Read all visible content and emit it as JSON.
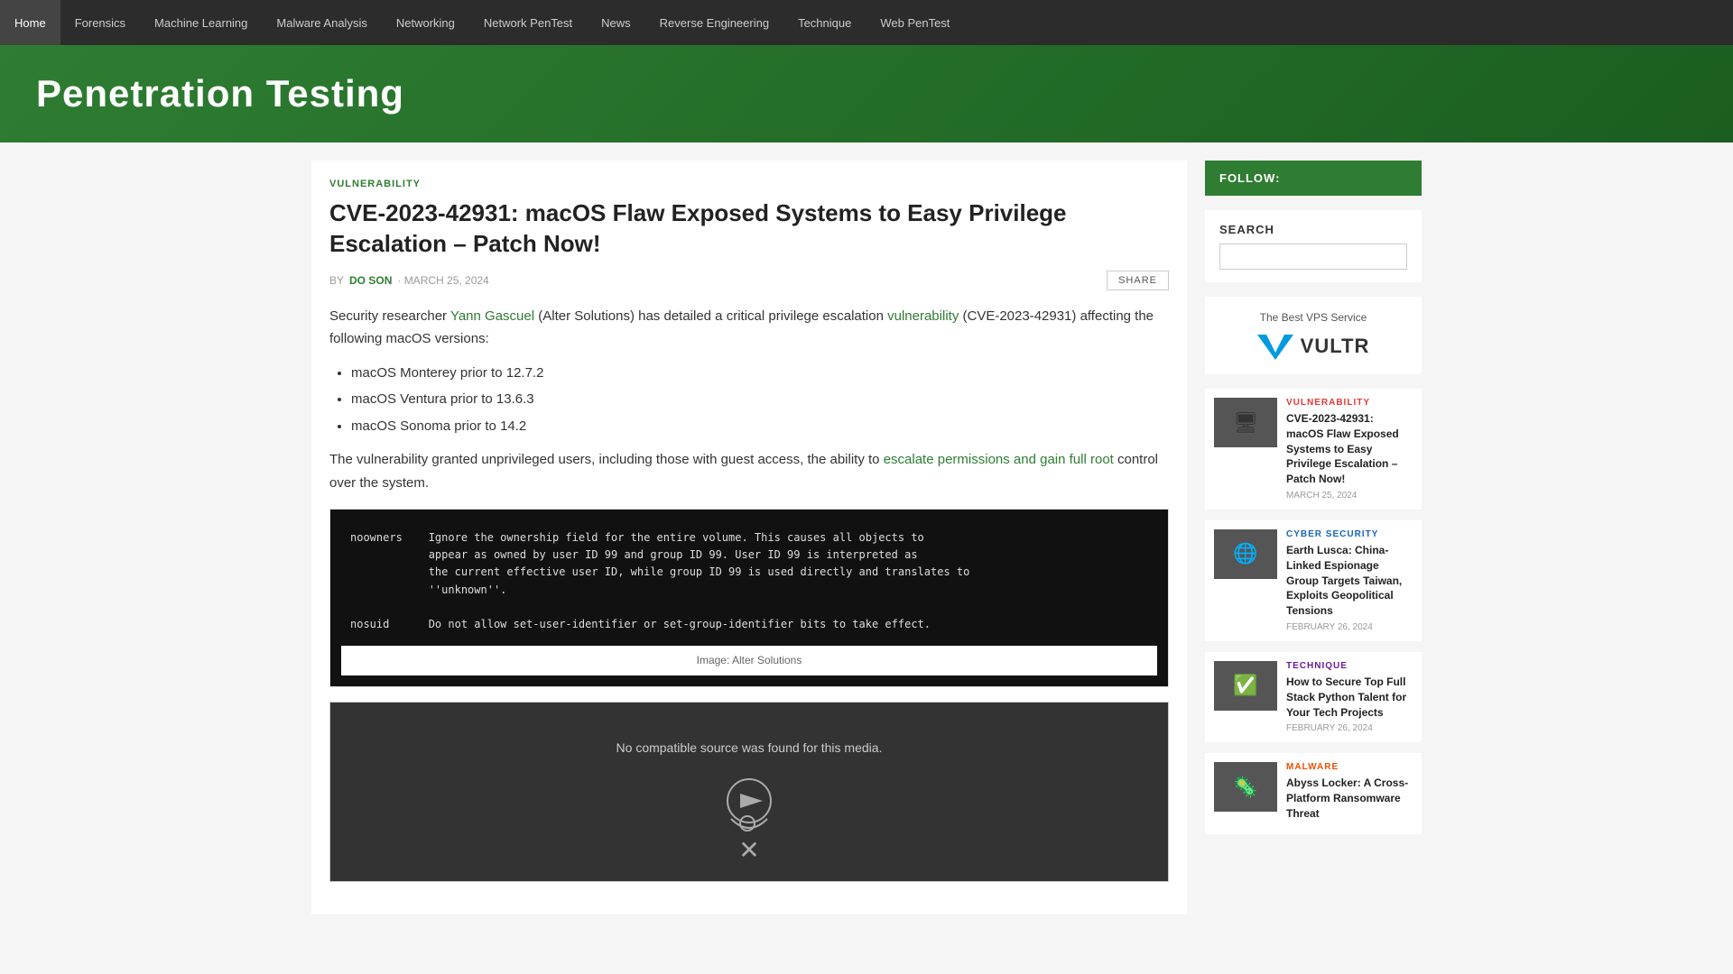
{
  "nav": {
    "items": [
      {
        "label": "Home",
        "active": false
      },
      {
        "label": "Forensics",
        "active": false
      },
      {
        "label": "Machine Learning",
        "active": false
      },
      {
        "label": "Malware Analysis",
        "active": false
      },
      {
        "label": "Networking",
        "active": false
      },
      {
        "label": "Network PenTest",
        "active": false
      },
      {
        "label": "News",
        "active": false
      },
      {
        "label": "Reverse Engineering",
        "active": false
      },
      {
        "label": "Technique",
        "active": false
      },
      {
        "label": "Web PenTest",
        "active": false
      }
    ]
  },
  "header": {
    "title": "Penetration Testing"
  },
  "article": {
    "category": "VULNERABILITY",
    "title": "CVE-2023-42931: macOS Flaw Exposed Systems to Easy Privilege Escalation – Patch Now!",
    "by": "BY",
    "author": "DO SON",
    "date": "· MARCH 25, 2024",
    "share_label": "SHARE",
    "intro": "Security researcher ",
    "researcher": "Yann Gascuel",
    "researcher_suffix": " (Alter Solutions) has detailed a critical privilege escalation ",
    "vuln_link": "vulnerability",
    "vuln_suffix": " (CVE-2023-42931) affecting the following macOS versions:",
    "versions": [
      "macOS Monterey prior to 12.7.2",
      "macOS Ventura prior to 13.6.3",
      "macOS Sonoma prior to 14.2"
    ],
    "body_p2_before": "The vulnerability granted unprivileged users, including those with guest access, the ability to ",
    "body_p2_link": "escalate permissions and gain full root",
    "body_p2_after": " control over the system.",
    "code_block": "noowners    Ignore the ownership field for the entire volume. This causes all objects to\n            appear as owned by user ID 99 and group ID 99. User ID 99 is interpreted as\n            the current effective user ID, while group ID 99 is used directly and translates to\n            ''unknown''.\n\nnosuid      Do not allow set-user-identifier or set-group-identifier bits to take effect.",
    "image_caption": "Image: Alter Solutions",
    "video_no_source": "No compatible source was found for this media."
  },
  "sidebar": {
    "follow_label": "FOLLOW:",
    "search_label": "SEARCH",
    "search_placeholder": "",
    "vps_title": "The Best VPS Service",
    "vps_name": "VULTR",
    "articles": [
      {
        "category": "VULNERABILITY",
        "cat_class": "vulnerability",
        "thumb_class": "thumb-vuln",
        "thumb_icon": "🖥",
        "title": "CVE-2023-42931: macOS Flaw Exposed Systems to Easy Privilege Escalation – Patch Now!",
        "date": "MARCH 25, 2024"
      },
      {
        "category": "CYBER SECURITY",
        "cat_class": "cyber",
        "thumb_class": "thumb-cyber",
        "thumb_icon": "🌐",
        "title": "Earth Lusca: China-Linked Espionage Group Targets Taiwan, Exploits Geopolitical Tensions",
        "date": "FEBRUARY 26, 2024"
      },
      {
        "category": "TECHNIQUE",
        "cat_class": "technique",
        "thumb_class": "thumb-tech",
        "thumb_icon": "✅",
        "title": "How to Secure Top Full Stack Python Talent for Your Tech Projects",
        "date": "FEBRUARY 26, 2024"
      },
      {
        "category": "MALWARE",
        "cat_class": "malware",
        "thumb_class": "thumb-mal",
        "thumb_icon": "🦠",
        "title": "Abyss Locker: A Cross-Platform Ransomware Threat",
        "date": ""
      }
    ]
  }
}
